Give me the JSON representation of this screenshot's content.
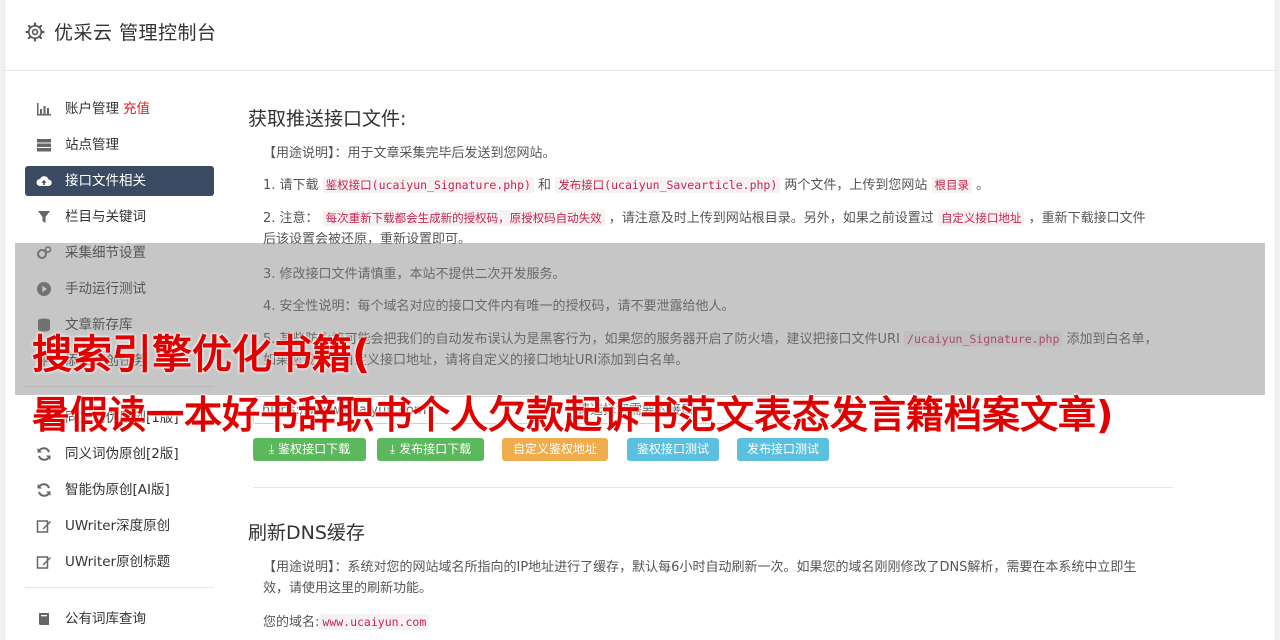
{
  "header": {
    "title": "优采云 管理控制台"
  },
  "sidebar": {
    "items": [
      {
        "label": "账户管理",
        "extra": "充值",
        "icon": "bar-chart-icon"
      },
      {
        "label": "站点管理",
        "icon": "server-icon"
      },
      {
        "label": "接口文件相关",
        "icon": "cloud-upload-icon",
        "active": true
      },
      {
        "label": "栏目与关键词",
        "icon": "filter-icon"
      },
      {
        "label": "采集细节设置",
        "icon": "gears-icon"
      },
      {
        "label": "手动运行测试",
        "icon": "play-circle-icon"
      },
      {
        "label": "文章新存库",
        "icon": "database-icon"
      },
      {
        "label": "添加原创任务",
        "icon": "plus-icon"
      },
      {
        "label": "同义词伪原创[1版]",
        "icon": "refresh-icon"
      },
      {
        "label": "同义词伪原创[2版]",
        "icon": "refresh-icon"
      },
      {
        "label": "智能伪原创[AI版]",
        "icon": "refresh-icon"
      },
      {
        "label": "UWriter深度原创",
        "icon": "edit-icon"
      },
      {
        "label": "UWriter原创标题",
        "icon": "edit-icon"
      },
      {
        "label": "公有词库查询",
        "icon": "book-icon"
      }
    ]
  },
  "section1": {
    "title": "获取推送接口文件:",
    "usage": "【用途说明】：用于文章采集完毕后发送到您网站。",
    "item1_a": "1. 请下载 ",
    "item1_code1": "鉴权接口(ucaiyun_Signature.php)",
    "item1_b": " 和 ",
    "item1_code2": "发布接口(ucaiyun_Savearticle.php)",
    "item1_c": " 两个文件，上传到您网站 ",
    "item1_code3": "根目录",
    "item1_d": " 。",
    "item2_a": "2. 注意： ",
    "item2_code1": "每次重新下载都会生成新的授权码，原授权码自动失效",
    "item2_b": " ，请注意及时上传到网站根目录。另外，如果之前设置过 ",
    "item2_code2": "自定义接口地址",
    "item2_c": " ，重新下载接口文件后该设置会被还原，重新设置即可。",
    "item3": "3. 修改接口文件请慎重，本站不提供二次开发服务。",
    "item4": "4. 安全性说明：每个域名对应的接口文件内有唯一的授权码，请不要泄露给他人。",
    "item5_a": "5. 某些防火墙可能会把我们的自动发布误认为是黑客行为，如果您的服务器开启了防火墙，建议把接口文件URI ",
    "item5_code": "/ucaiyun_Signature.php",
    "item5_b": " 添加到白名单，如果您设置了自定义接口地址，请将自定义的接口地址URI添加到白名单。",
    "url_value": "https://www.ucaiyun.com",
    "select_value": "请选择您需要的接口",
    "buttons": [
      "鉴权接口下载",
      "发布接口下载",
      "自定义鉴权地址",
      "鉴权接口测试",
      "发布接口测试"
    ]
  },
  "section2": {
    "title": "刷新DNS缓存",
    "usage": "【用途说明】：系统对您的网站域名所指向的IP地址进行了缓存，默认每6小时自动刷新一次。如果您的域名刚刚修改了DNS解析，需要在本系统中立即生效，请使用这里的刷新功能。",
    "domain_label": "您的域名:",
    "domain_value": "www.ucaiyun.com"
  },
  "overlay": {
    "line1": "搜索引擎优化书籍(",
    "line2": "暑假读一本好书辞职书个人欠款起诉书范文表态发言籍档案文章)"
  }
}
